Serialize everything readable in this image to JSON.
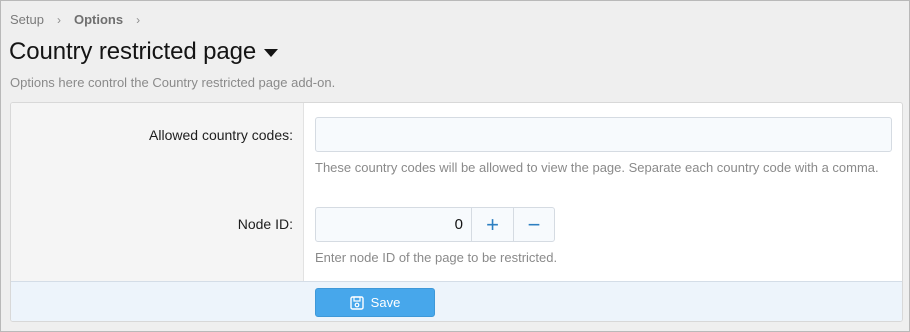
{
  "breadcrumb": {
    "items": [
      {
        "label": "Setup"
      },
      {
        "label": "Options"
      }
    ],
    "separator": "›"
  },
  "page": {
    "title": "Country restricted page",
    "description": "Options here control the Country restricted page add-on."
  },
  "form": {
    "allowed_codes": {
      "label": "Allowed country codes:",
      "value": "",
      "explain": "These country codes will be allowed to view the page. Separate each country code with a comma."
    },
    "node_id": {
      "label": "Node ID:",
      "value": "0",
      "plus_glyph": "+",
      "minus_glyph": "−",
      "explain": "Enter node ID of the page to be restricted."
    }
  },
  "footer": {
    "save_label": "Save"
  },
  "icons": {
    "title_menu": "caret-down-icon",
    "save": "save-icon"
  },
  "colors": {
    "accent": "#47a7eb",
    "link_blue": "#2d7fc1",
    "footer_bg": "#edf4fb"
  }
}
